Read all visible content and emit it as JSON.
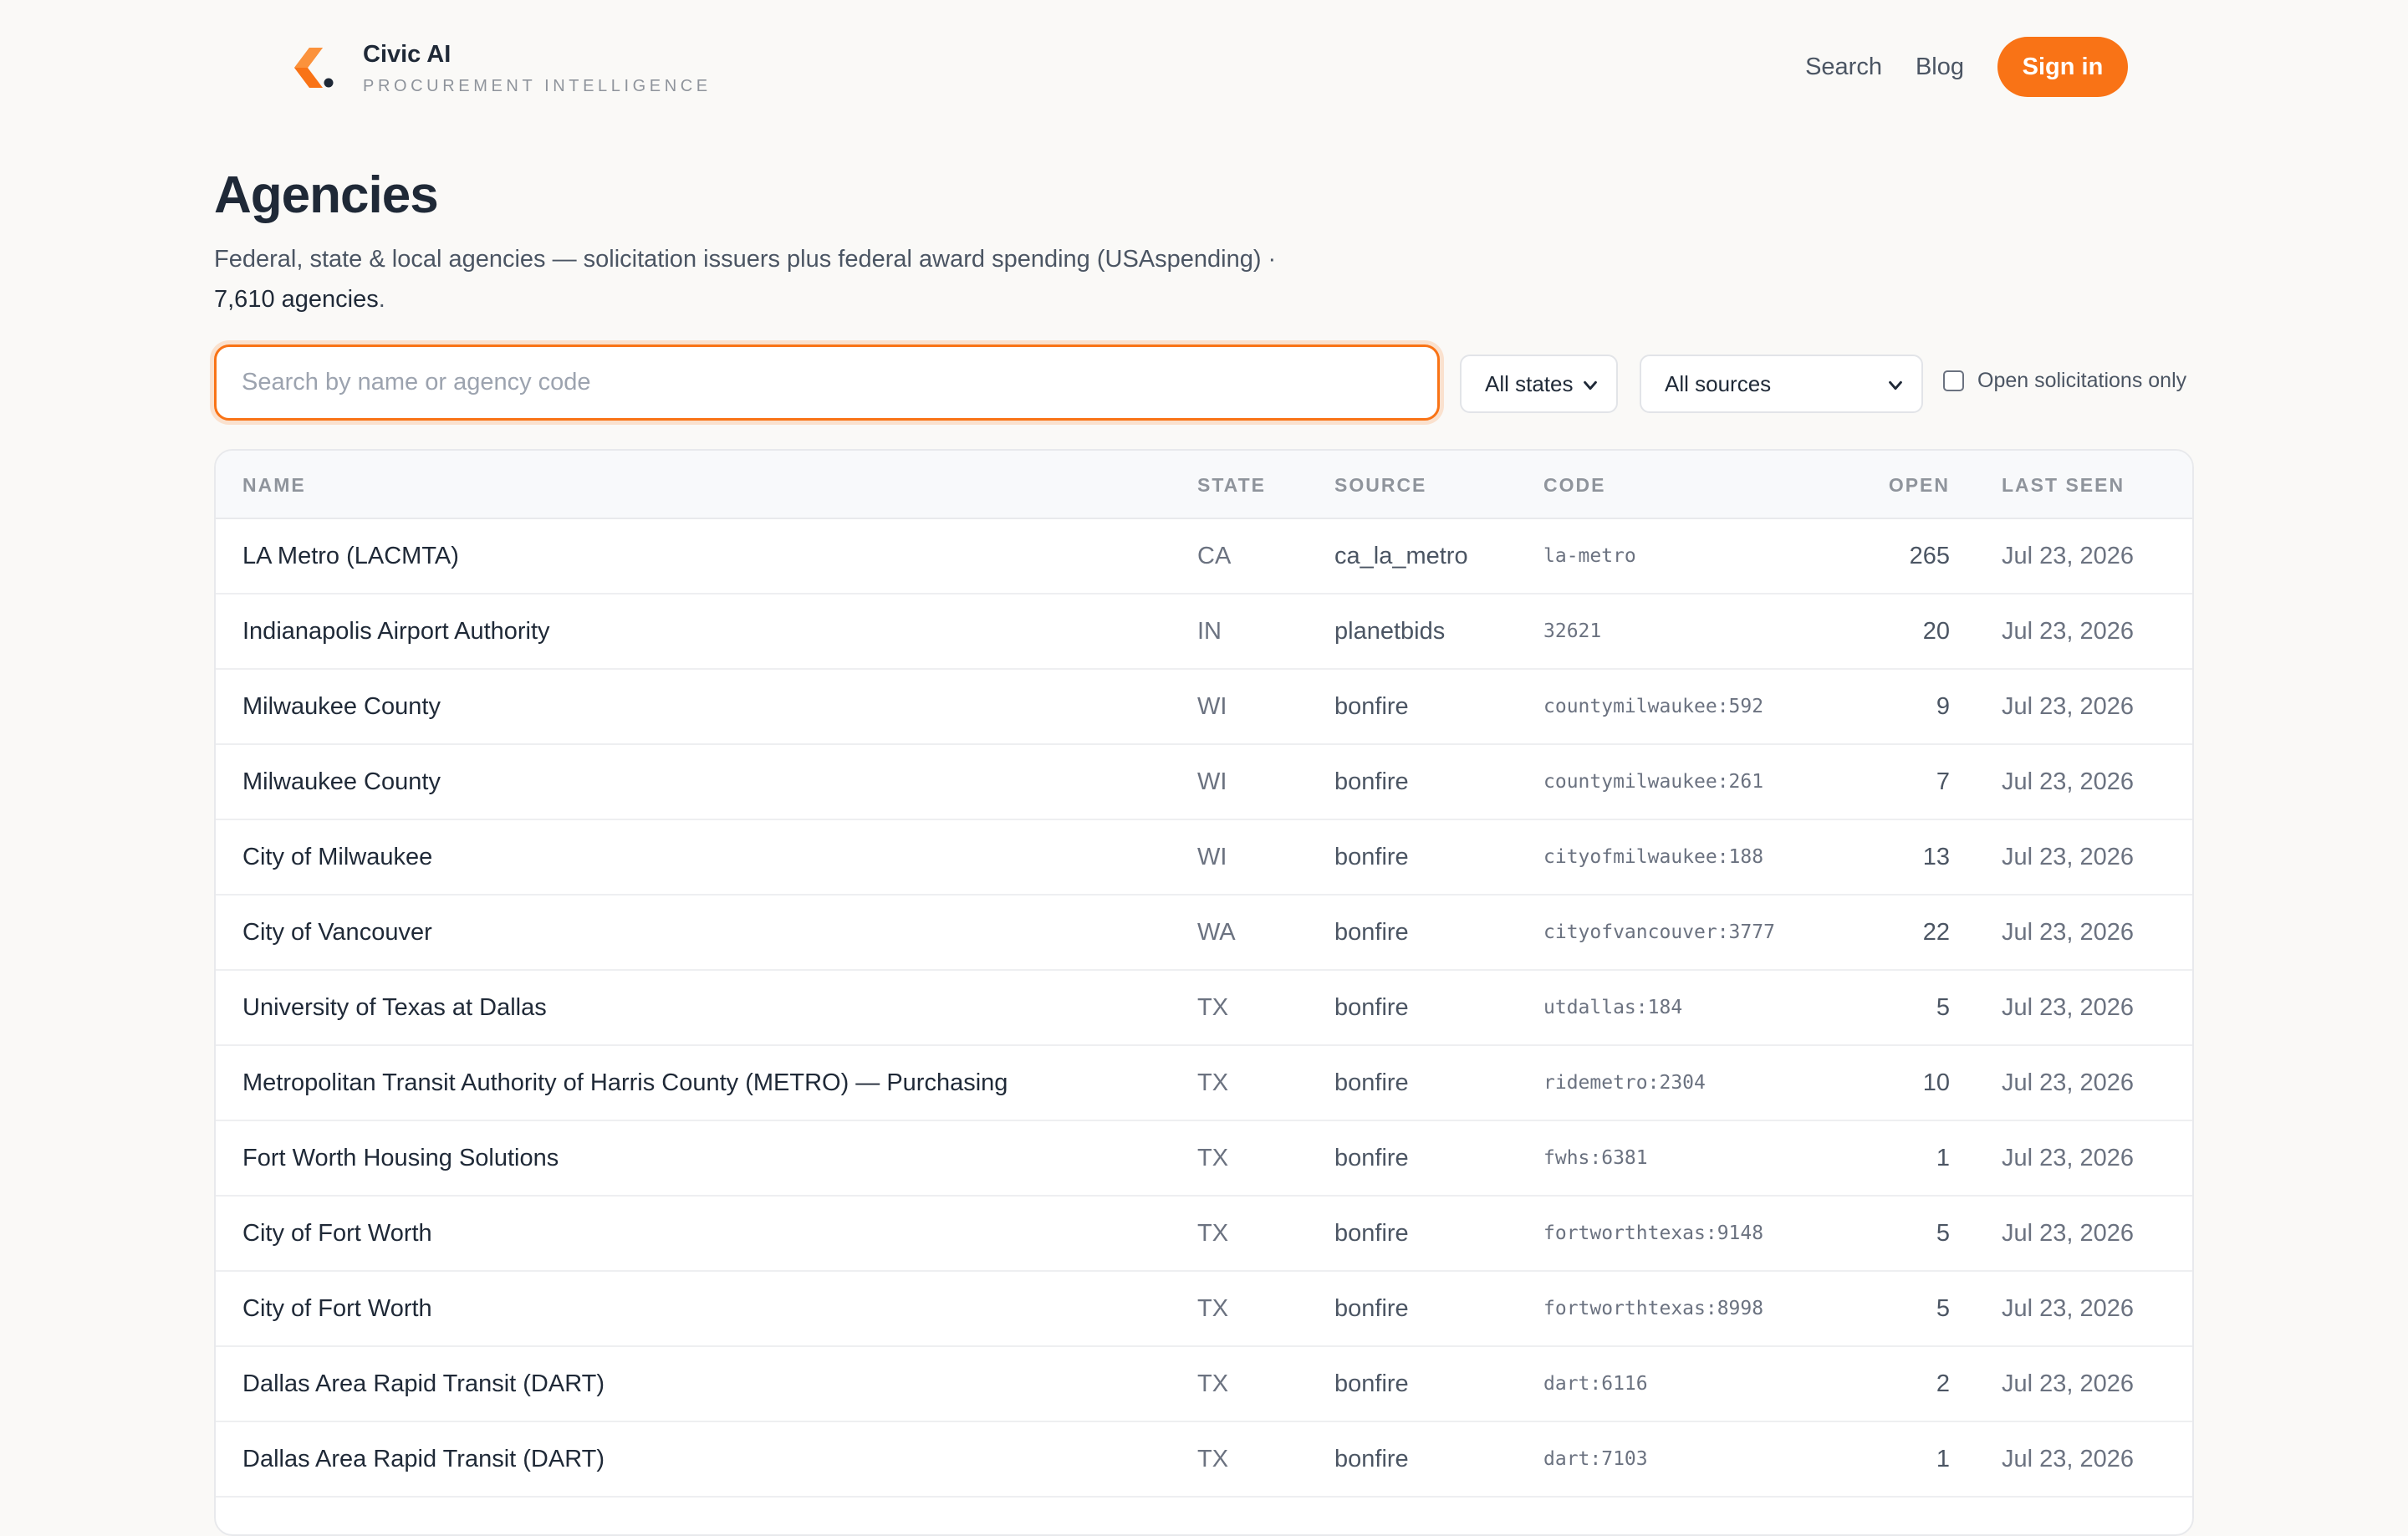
{
  "brand": {
    "name": "Civic AI",
    "tagline": "PROCUREMENT INTELLIGENCE",
    "accent_color": "#f97316"
  },
  "nav": {
    "search_label": "Search",
    "blog_label": "Blog",
    "signin_label": "Sign in"
  },
  "page": {
    "title": "Agencies",
    "subtitle": "Federal, state & local agencies — solicitation issuers plus federal award spending (USAspending) ·",
    "count": "7,610 agencies",
    "count_suffix": "."
  },
  "filters": {
    "search_placeholder": "Search by name or agency code",
    "search_value": "",
    "state_selected": "All states",
    "source_selected": "All sources",
    "open_only_label": "Open solicitations only",
    "open_only_checked": false
  },
  "table": {
    "columns": [
      "NAME",
      "STATE",
      "SOURCE",
      "CODE",
      "OPEN",
      "LAST SEEN"
    ],
    "rows": [
      {
        "name": "LA Metro (LACMTA)",
        "state": "CA",
        "source": "ca_la_metro",
        "code": "la-metro",
        "open": "265",
        "last_seen": "Jul 23, 2026"
      },
      {
        "name": "Indianapolis Airport Authority",
        "state": "IN",
        "source": "planetbids",
        "code": "32621",
        "open": "20",
        "last_seen": "Jul 23, 2026"
      },
      {
        "name": "Milwaukee County",
        "state": "WI",
        "source": "bonfire",
        "code": "countymilwaukee:592",
        "open": "9",
        "last_seen": "Jul 23, 2026"
      },
      {
        "name": "Milwaukee County",
        "state": "WI",
        "source": "bonfire",
        "code": "countymilwaukee:261",
        "open": "7",
        "last_seen": "Jul 23, 2026"
      },
      {
        "name": "City of Milwaukee",
        "state": "WI",
        "source": "bonfire",
        "code": "cityofmilwaukee:188",
        "open": "13",
        "last_seen": "Jul 23, 2026"
      },
      {
        "name": "City of Vancouver",
        "state": "WA",
        "source": "bonfire",
        "code": "cityofvancouver:3777",
        "open": "22",
        "last_seen": "Jul 23, 2026"
      },
      {
        "name": "University of Texas at Dallas",
        "state": "TX",
        "source": "bonfire",
        "code": "utdallas:184",
        "open": "5",
        "last_seen": "Jul 23, 2026"
      },
      {
        "name": "Metropolitan Transit Authority of Harris County (METRO) — Purchasing",
        "state": "TX",
        "source": "bonfire",
        "code": "ridemetro:2304",
        "open": "10",
        "last_seen": "Jul 23, 2026"
      },
      {
        "name": "Fort Worth Housing Solutions",
        "state": "TX",
        "source": "bonfire",
        "code": "fwhs:6381",
        "open": "1",
        "last_seen": "Jul 23, 2026"
      },
      {
        "name": "City of Fort Worth",
        "state": "TX",
        "source": "bonfire",
        "code": "fortworthtexas:9148",
        "open": "5",
        "last_seen": "Jul 23, 2026"
      },
      {
        "name": "City of Fort Worth",
        "state": "TX",
        "source": "bonfire",
        "code": "fortworthtexas:8998",
        "open": "5",
        "last_seen": "Jul 23, 2026"
      },
      {
        "name": "Dallas Area Rapid Transit (DART)",
        "state": "TX",
        "source": "bonfire",
        "code": "dart:6116",
        "open": "2",
        "last_seen": "Jul 23, 2026"
      },
      {
        "name": "Dallas Area Rapid Transit (DART)",
        "state": "TX",
        "source": "bonfire",
        "code": "dart:7103",
        "open": "1",
        "last_seen": "Jul 23, 2026"
      }
    ]
  }
}
